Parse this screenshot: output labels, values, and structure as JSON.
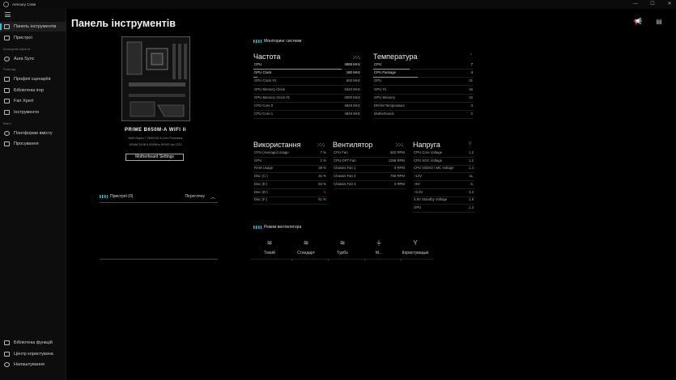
{
  "window": {
    "title": "Armoury Crate",
    "min": "—",
    "max": "☐",
    "close": "✕"
  },
  "sidebar": {
    "main_items": [
      {
        "label": "Панель інструментів",
        "icon": "dashboard-icon"
      },
      {
        "label": "Пристрої",
        "icon": "devices-icon"
      }
    ],
    "section1": "Кольорові ефекти",
    "aura": {
      "label": "Aura Sync",
      "icon": "aura-icon"
    },
    "section2": "Розклад",
    "tools": [
      {
        "label": "Профілі сценаріїв",
        "icon": "profiles-icon"
      },
      {
        "label": "Бібліотека ігор",
        "icon": "game-library-icon"
      },
      {
        "label": "Fan Xpert",
        "icon": "fan-icon"
      },
      {
        "label": "Інструменти",
        "icon": "tools-icon"
      }
    ],
    "section3": "Вміст",
    "content": [
      {
        "label": "Платформи вмісту",
        "icon": "platforms-icon"
      },
      {
        "label": "Просування",
        "icon": "promotion-icon"
      }
    ],
    "bottom": [
      {
        "label": "Бібліотека функцій",
        "icon": "feature-library-icon"
      },
      {
        "label": "Центр користувача",
        "icon": "user-center-icon"
      },
      {
        "label": "Налаштування",
        "icon": "settings-icon"
      }
    ]
  },
  "header": {
    "title": "Панель інструментів"
  },
  "motherboard": {
    "name": "PRIME B650M-A WIFI II",
    "cpu": "AMD Ryzen 7 7800X3D 8-Core Processor",
    "ram": "DRAM 32GB 6,000MHz DRIVE ver.2222",
    "button": "Motherboard Settings"
  },
  "devices": {
    "title": "Пристрої (0)",
    "action": "Перегляну"
  },
  "monitoring": {
    "title": "Моніторинг системи",
    "frequency": {
      "title": "Частота",
      "rows": [
        {
          "label": "CPU",
          "value": "4858 MHz",
          "bar": 0.82
        },
        {
          "label": "GPU Clock",
          "value": "180 MHz",
          "bar": 0.04
        },
        {
          "label": "GPU Clock #1",
          "value": "600 MHz"
        },
        {
          "label": "GPU Memory Clock",
          "value": "1620 MHz"
        },
        {
          "label": "GPU Memory Clock #1",
          "value": "3000 MHz"
        },
        {
          "label": "CPU Core 0",
          "value": "4849 MHz"
        },
        {
          "label": "CPU Core 1",
          "value": "4849 MHz"
        }
      ]
    },
    "temperature": {
      "title": "Температура",
      "unit": "°",
      "rows": [
        {
          "label": "CPU",
          "value": "7",
          "bar": 0.36
        },
        {
          "label": "CPU Package",
          "value": "4",
          "bar": 0.44
        },
        {
          "label": "GPU",
          "value": "31"
        },
        {
          "label": "GPU #1",
          "value": "46"
        },
        {
          "label": "GPU Memory",
          "value": "42"
        },
        {
          "label": "DRAM Temperature",
          "value": "3"
        },
        {
          "label": "Motherboard",
          "value": "2"
        }
      ]
    },
    "usage": {
      "title": "Використання",
      "rows": [
        {
          "label": "CPU (Average) Usage",
          "value": "7 %"
        },
        {
          "label": "GPU",
          "value": "1 %"
        },
        {
          "label": "RAM Usage",
          "value": "39 %"
        },
        {
          "label": "Disc (C:)",
          "value": "31 %"
        },
        {
          "label": "Disc (E:)",
          "value": "84 %"
        },
        {
          "label": "Disc (D:)",
          "value": "%"
        },
        {
          "label": "Disc (F:)",
          "value": "51 %"
        }
      ]
    },
    "fans": {
      "title": "Вентилятор",
      "rows": [
        {
          "label": "CPU Fan",
          "value": "902 RPM"
        },
        {
          "label": "CPU OPT Fan",
          "value": "1358 RPM"
        },
        {
          "label": "Chassis Fan 1",
          "value": "0 RPM"
        },
        {
          "label": "Chassis Fan 2",
          "value": "756 RPM"
        },
        {
          "label": "Chassis Fan 3",
          "value": "0 RPM"
        }
      ]
    },
    "voltage": {
      "title": "Напруга",
      "unit": "V",
      "rows": [
        {
          "label": "CPU Core Voltage",
          "value": "1,2"
        },
        {
          "label": "CPU SOC Voltage",
          "value": "1,2"
        },
        {
          "label": "CPU VDDIO / MC Voltage",
          "value": "1,4"
        },
        {
          "label": "+12V",
          "value": "11,"
        },
        {
          "label": "+5V",
          "value": "5,"
        },
        {
          "label": "+3.3V",
          "value": "3,3"
        },
        {
          "label": "3.8V Standby Voltage",
          "value": "1,8"
        },
        {
          "label": "GPU",
          "value": "1,2"
        }
      ]
    }
  },
  "fan_mode": {
    "title": "Режим вентилятора",
    "options": [
      {
        "label": "Тихий",
        "icon": "silent-fan-icon",
        "glyph": "≋"
      },
      {
        "label": "Стандарт",
        "icon": "standard-fan-icon",
        "glyph": "≋"
      },
      {
        "label": "Турбо",
        "icon": "turbo-fan-icon",
        "glyph": "≋"
      },
      {
        "label": "М...",
        "icon": "max-fan-icon",
        "glyph": "⏚"
      },
      {
        "label": "Користувацькі",
        "icon": "custom-fan-icon",
        "glyph": "Y"
      }
    ]
  }
}
